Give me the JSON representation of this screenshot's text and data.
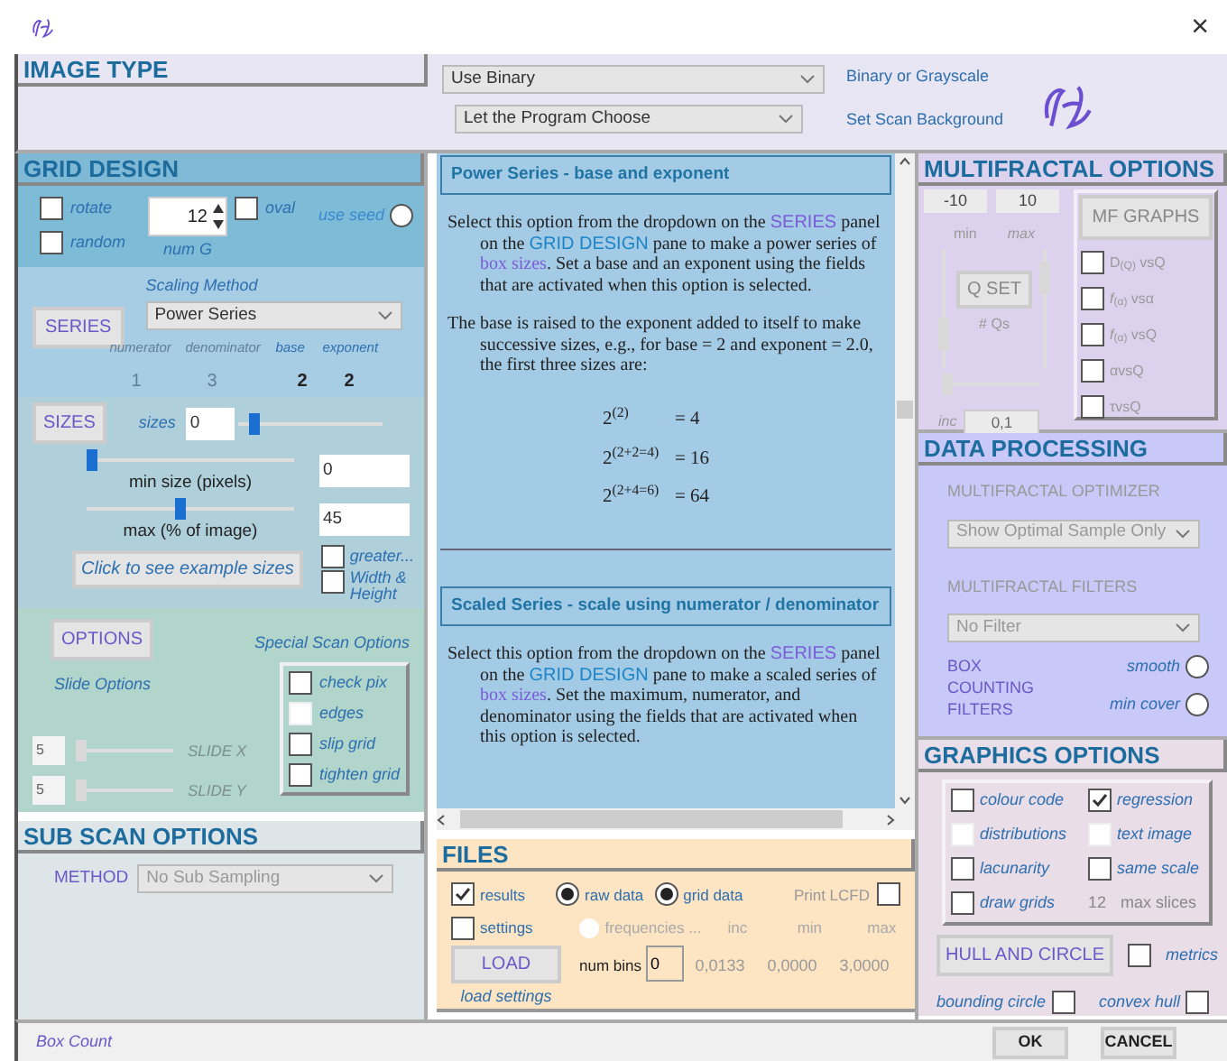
{
  "window": {
    "close": "×"
  },
  "image_type": {
    "title": "IMAGE TYPE",
    "image_select": "Use Binary",
    "image_label": "Binary or Grayscale",
    "background_select": "Let the Program Choose",
    "background_label": "Set Scan Background"
  },
  "grid_design": {
    "title": "GRID DESIGN",
    "rotate": {
      "label": "rotate",
      "checked": false
    },
    "random": {
      "label": "random",
      "checked": false
    },
    "num_g": {
      "value": "12",
      "label": "num G"
    },
    "oval": {
      "label": "oval",
      "checked": false
    },
    "use_seed": {
      "label": "use seed",
      "selected": false
    },
    "series": {
      "button": "SERIES",
      "method_label": "Scaling Method",
      "method": "Power Series",
      "params": [
        {
          "label": "numerator",
          "value": "1",
          "disabled": true
        },
        {
          "label": "denominator",
          "value": "3",
          "disabled": true
        },
        {
          "label": "base",
          "value": "2",
          "disabled": false
        },
        {
          "label": "exponent",
          "value": "2",
          "disabled": false
        }
      ]
    },
    "sizes": {
      "button": "SIZES",
      "label": "sizes",
      "value": "0",
      "level": 0.07,
      "min_label": "min size (pixels)",
      "min_value": "0",
      "min_slider": {
        "level": 0
      },
      "max_label": "max (% of image)",
      "max_value": "45",
      "max_slider": {
        "level": 0.45
      },
      "example_button": "Click to see example sizes",
      "greater": {
        "label": "greater...",
        "checked": false
      },
      "width_height": {
        "label": "Width & Height",
        "checked": false
      }
    },
    "options": {
      "button": "OPTIONS",
      "slide_label": "Slide Options",
      "special_label": "Special Scan Options",
      "slides": [
        {
          "value": "5",
          "label": "SLIDE X",
          "level": 0
        },
        {
          "value": "5",
          "label": "SLIDE Y",
          "level": 0
        }
      ],
      "special": [
        {
          "label": "check pix",
          "checked": false,
          "disabled": false
        },
        {
          "label": "edges",
          "checked": false,
          "disabled": true
        },
        {
          "label": "slip grid",
          "checked": false,
          "disabled": false
        },
        {
          "label": "tighten grid",
          "checked": false,
          "disabled": false
        }
      ]
    }
  },
  "sub_scan": {
    "title": "SUB SCAN OPTIONS",
    "method_label": "METHOD",
    "method": "No Sub Sampling"
  },
  "help": {
    "sections": [
      {
        "title": "Power Series - base and exponent",
        "paragraphs": [
          [
            {
              "kind": "text",
              "text": "Select this option from the dropdown on the "
            },
            {
              "kind": "panel",
              "text": "SERIES"
            },
            {
              "kind": "text",
              "text": " panel on the "
            },
            {
              "kind": "pane",
              "text": "GRID DESIGN"
            },
            {
              "kind": "text",
              "text": " pane to make a power series of "
            },
            {
              "kind": "term",
              "text": "box sizes"
            },
            {
              "kind": "text",
              "text": ". Set a base and an exponent using the fields that are activated when this option is selected."
            }
          ],
          [
            {
              "kind": "text",
              "text": "The base is raised to the exponent added to itself to make successive sizes, e.g., for base = 2 and exponent = 2.0, the first three sizes are:"
            }
          ]
        ],
        "formulas": [
          {
            "power": "2$^{(2)}$",
            "result": "=  4"
          },
          {
            "power": "2$^{(2+2=4)}$",
            "result": "=  16"
          },
          {
            "power": "2$^{(2+4=6)}$",
            "result": "=  64"
          }
        ]
      },
      {
        "title": "Scaled Series - scale using numerator / denominator",
        "paragraphs": [
          [
            {
              "kind": "text",
              "text": "Select this option from the dropdown on the "
            },
            {
              "kind": "panel",
              "text": "SERIES"
            },
            {
              "kind": "text",
              "text": " panel on the "
            },
            {
              "kind": "pane",
              "text": "GRID DESIGN"
            },
            {
              "kind": "text",
              "text": " pane to make a scaled series of "
            },
            {
              "kind": "term",
              "text": "box sizes"
            },
            {
              "kind": "text",
              "text": ". Set the maximum, numerator, and denominator using the fields that are activated when this option is selected."
            }
          ]
        ]
      }
    ]
  },
  "files": {
    "title": "FILES",
    "results": {
      "label": "results",
      "checked": true
    },
    "raw": {
      "label": "raw data",
      "selected": true
    },
    "grid": {
      "label": "grid data",
      "selected": true
    },
    "print": {
      "label": "Print LCFD",
      "checked": false
    },
    "settings": {
      "label": "settings",
      "checked": false
    },
    "frequencies": {
      "label": "frequencies ...",
      "selected": false
    },
    "stats": [
      {
        "label": "inc",
        "value": "0,0133"
      },
      {
        "label": "min",
        "value": "0,0000"
      },
      {
        "label": "max",
        "value": "3,0000"
      }
    ],
    "load": "LOAD",
    "load_label": "load settings",
    "bins_label": "num bins",
    "bins": "0"
  },
  "multifractal": {
    "title": "MULTIFRACTAL OPTIONS",
    "min_value": "-10",
    "max_value": "10",
    "min_label": "min",
    "max_label": "max",
    "min_slider": {
      "level": 0.2
    },
    "max_slider": {
      "level": 0.85
    },
    "qset": "Q SET",
    "qs_label": "# Qs",
    "qs_slider": {
      "level": 0
    },
    "inc_label": "inc",
    "inc_value": "0,1",
    "graphs_button": "MF GRAPHS",
    "graphs": [
      {
        "label": "D$_{(Q)}$ vsQ",
        "checked": false
      },
      {
        "label": "*f*$_{(α)}$ vsα",
        "checked": false
      },
      {
        "label": "*f*$_{(α)}$ vsQ",
        "checked": false
      },
      {
        "label": "αvsQ",
        "checked": false
      },
      {
        "label": "τvsQ",
        "checked": false
      }
    ]
  },
  "data_processing": {
    "title": "DATA PROCESSING",
    "optimizer_label": "MULTIFRACTAL OPTIMIZER",
    "optimizer": "Show Optimal Sample Only",
    "filters_label": "MULTIFRACTAL FILTERS",
    "filter": "No Filter",
    "box_label": "BOX COUNTING FILTERS",
    "smooth": {
      "label": "smooth",
      "selected": false
    },
    "min_cover": {
      "label": "min cover",
      "selected": false
    }
  },
  "graphics": {
    "title": "GRAPHICS OPTIONS",
    "options": [
      {
        "kind": "check",
        "label": "colour code",
        "checked": false,
        "disabled": false
      },
      {
        "kind": "check",
        "label": "regression",
        "checked": true,
        "disabled": false
      },
      {
        "kind": "check",
        "label": "distributions",
        "checked": false,
        "disabled": true
      },
      {
        "kind": "check",
        "label": "text image",
        "checked": false,
        "disabled": true
      },
      {
        "kind": "check",
        "label": "lacunarity",
        "checked": false,
        "disabled": false
      },
      {
        "kind": "check",
        "label": "same scale",
        "checked": false,
        "disabled": false
      },
      {
        "kind": "check",
        "label": "draw grids",
        "checked": false,
        "disabled": false
      },
      {
        "kind": "number",
        "value": "12",
        "label": "max slices"
      }
    ],
    "hull_button": "HULL AND CIRCLE",
    "metrics": {
      "label": "metrics",
      "checked": false
    },
    "bounding": {
      "label": "bounding circle",
      "checked": false
    },
    "convex": {
      "label": "convex hull",
      "checked": false
    }
  },
  "status": {
    "text": "Box Count"
  },
  "buttons": [
    "OK",
    "CANCEL"
  ]
}
